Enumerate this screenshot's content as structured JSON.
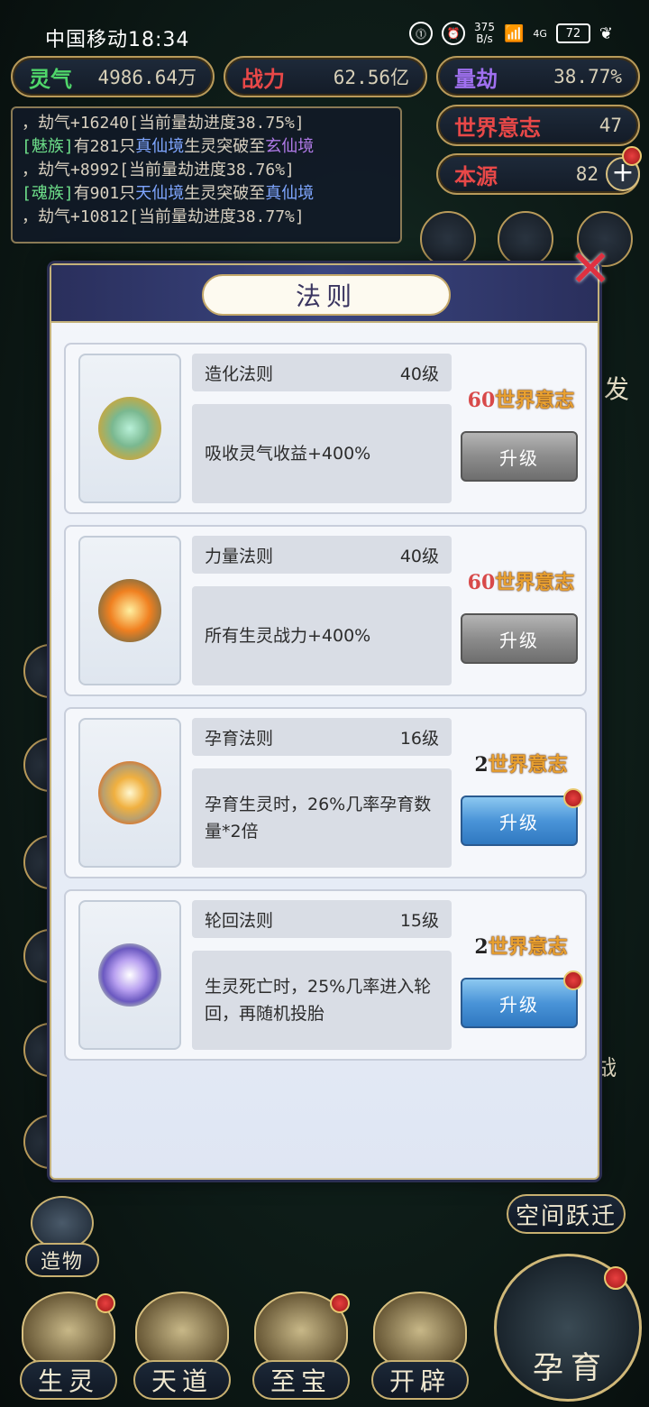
{
  "status_bar": {
    "carrier_time": "中国移动18:34",
    "net_speed_value": "375",
    "net_speed_unit": "B/s",
    "signal": "4G",
    "battery": "72"
  },
  "stats": {
    "lingqi": {
      "label": "灵气",
      "value": "4986.64万",
      "color": "#4fd66a"
    },
    "zhanli": {
      "label": "战力",
      "value": "62.56亿",
      "color": "#e84848"
    },
    "liangjie": {
      "label": "量劫",
      "value": "38.77%",
      "color": "#a070f0"
    },
    "world_will": {
      "label": "世界意志",
      "value": "47",
      "color": "#e84848"
    },
    "benyuan": {
      "label": "本源",
      "value": "82",
      "color": "#e84848"
    }
  },
  "log": {
    "line1": "，劫气+16240[当前量劫进度38.75%]",
    "line2_bracket": "[魅族]",
    "line2_a": "有281只",
    "line2_realm1": "真仙境",
    "line2_b": "生灵突破至",
    "line2_realm2": "玄仙境",
    "line3": "，劫气+8992[当前量劫进度38.76%]",
    "line4_bracket": "[魂族]",
    "line4_a": "有901只",
    "line4_realm1": "天仙境",
    "line4_b": "生灵突破至",
    "line4_realm2": "真仙境",
    "line5": "，劫气+10812[当前量劫进度38.77%]"
  },
  "side_labels": {
    "right_fa": "发",
    "right_zhan": "战"
  },
  "modal": {
    "title": "法则",
    "close_glyph": "✕",
    "cards": [
      {
        "name": "造化法则",
        "level": "40级",
        "desc": "吸收灵气收益+400%",
        "cost_num": "60",
        "cost_word": "世界意志",
        "button": "升级"
      },
      {
        "name": "力量法则",
        "level": "40级",
        "desc": "所有生灵战力+400%",
        "cost_num": "60",
        "cost_word": "世界意志",
        "button": "升级"
      },
      {
        "name": "孕育法则",
        "level": "16级",
        "desc": "孕育生灵时，26%几率孕育数量*2倍",
        "cost_num": "2",
        "cost_word": "世界意志",
        "button": "升级"
      },
      {
        "name": "轮回法则",
        "level": "15级",
        "desc": "生灵死亡时，25%几率进入轮回，再随机投胎",
        "cost_num": "2",
        "cost_word": "世界意志",
        "button": "升级"
      }
    ]
  },
  "bottom": {
    "create": "造物",
    "space_jump": "空间跃迁",
    "nav": [
      "生灵",
      "天道",
      "至宝",
      "开辟"
    ],
    "big_nav": "孕育"
  }
}
